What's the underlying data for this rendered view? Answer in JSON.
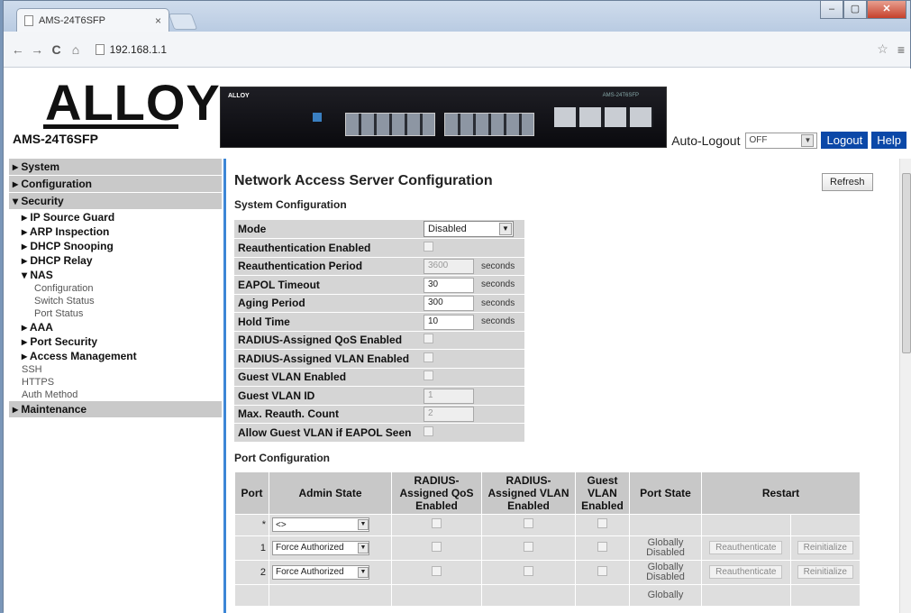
{
  "browser": {
    "tab_title": "AMS-24T6SFP",
    "tab_close": "×",
    "url": "192.168.1.1",
    "back": "←",
    "forward": "→",
    "reload": "C",
    "home": "⌂",
    "star": "☆",
    "menu": "≡",
    "min": "–",
    "max": "▢",
    "close": "✕"
  },
  "header": {
    "logo": "ALLOY",
    "model": "AMS-24T6SFP",
    "device_brand": "ALLOY",
    "device_tag": "AMS-24T6SFP",
    "auto_logout_label": "Auto-Logout",
    "auto_logout_value": "OFF",
    "logout": "Logout",
    "help": "Help"
  },
  "sidebar": {
    "system": "▸ System",
    "configuration": "▸ Configuration",
    "security": "▾ Security",
    "ip_source_guard": "▸ IP Source Guard",
    "arp_inspection": "▸ ARP Inspection",
    "dhcp_snooping": "▸ DHCP Snooping",
    "dhcp_relay": "▸ DHCP Relay",
    "nas": "▾ NAS",
    "nas_configuration": "Configuration",
    "nas_switch_status": "Switch Status",
    "nas_port_status": "Port Status",
    "aaa": "▸ AAA",
    "port_security": "▸ Port Security",
    "access_management": "▸ Access Management",
    "ssh": "SSH",
    "https": "HTTPS",
    "auth_method": "Auth Method",
    "maintenance": "▸ Maintenance"
  },
  "main": {
    "title": "Network Access Server Configuration",
    "refresh": "Refresh",
    "system_config_title": "System Configuration",
    "port_config_title": "Port Configuration",
    "sys": {
      "mode_label": "Mode",
      "mode_value": "Disabled",
      "reauth_enabled_label": "Reauthentication Enabled",
      "reauth_period_label": "Reauthentication Period",
      "reauth_period_value": "3600",
      "eapol_timeout_label": "EAPOL Timeout",
      "eapol_timeout_value": "30",
      "aging_period_label": "Aging Period",
      "aging_period_value": "300",
      "hold_time_label": "Hold Time",
      "hold_time_value": "10",
      "radius_qos_label": "RADIUS-Assigned QoS Enabled",
      "radius_vlan_label": "RADIUS-Assigned VLAN Enabled",
      "guest_vlan_enabled_label": "Guest VLAN Enabled",
      "guest_vlan_id_label": "Guest VLAN ID",
      "guest_vlan_id_value": "1",
      "max_reauth_label": "Max. Reauth. Count",
      "max_reauth_value": "2",
      "allow_guest_label": "Allow Guest VLAN if EAPOL Seen",
      "seconds": "seconds"
    },
    "ports_headers": {
      "port": "Port",
      "admin_state": "Admin State",
      "radius_qos": "RADIUS-Assigned QoS Enabled",
      "radius_vlan": "RADIUS-Assigned VLAN Enabled",
      "guest_vlan": "Guest VLAN Enabled",
      "port_state": "Port State",
      "restart": "Restart"
    },
    "port_rows": [
      {
        "port": "*",
        "admin": "<>",
        "state": ""
      },
      {
        "port": "1",
        "admin": "Force Authorized",
        "state": "Globally Disabled"
      },
      {
        "port": "2",
        "admin": "Force Authorized",
        "state": "Globally Disabled"
      },
      {
        "port": "",
        "admin": "",
        "state": "Globally"
      }
    ],
    "reauthenticate": "Reauthenticate",
    "reinitialize": "Reinitialize"
  }
}
